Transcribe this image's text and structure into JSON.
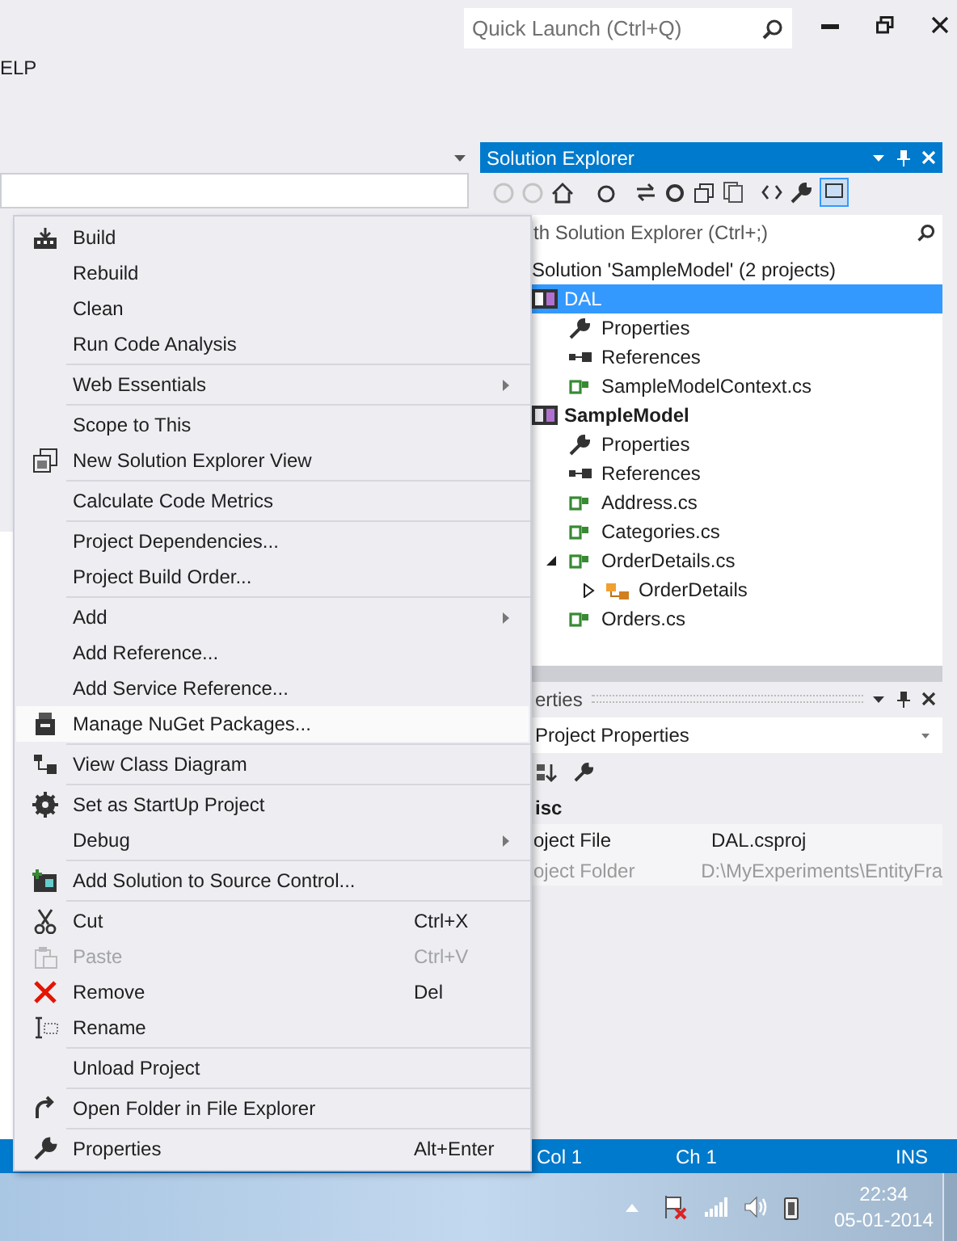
{
  "window": {
    "quick_launch": {
      "placeholder": "Quick Launch (Ctrl+Q)"
    }
  },
  "menu_bar": {
    "label": "ELP"
  },
  "solution_explorer": {
    "title": "Solution Explorer",
    "search": {
      "placeholder": "th Solution Explorer (Ctrl+;)"
    },
    "tree": [
      {
        "label": "Solution 'SampleModel' (2 projects)",
        "selected": false,
        "children": [
          {
            "label": "DAL",
            "kind": "project",
            "startup": false,
            "selected": true,
            "children": [
              {
                "label": "Properties",
                "kind": "properties",
                "selected": false
              },
              {
                "label": "References",
                "kind": "references",
                "selected": false
              },
              {
                "label": "SampleModelContext.cs",
                "kind": "file",
                "selected": false
              }
            ]
          },
          {
            "label": "SampleModel",
            "kind": "project",
            "startup": true,
            "selected": false,
            "children": [
              {
                "label": "Properties",
                "kind": "properties",
                "selected": false
              },
              {
                "label": "References",
                "kind": "references",
                "selected": false
              },
              {
                "label": "Address.cs",
                "kind": "file",
                "selected": false
              },
              {
                "label": "Categories.cs",
                "kind": "file",
                "selected": false
              },
              {
                "label": "OrderDetails.cs",
                "kind": "file",
                "selected": false,
                "expanded": true,
                "children": [
                  {
                    "label": "OrderDetails",
                    "kind": "class",
                    "selected": false,
                    "expanded": false
                  }
                ]
              },
              {
                "label": "Orders.cs",
                "kind": "file",
                "selected": false
              }
            ]
          }
        ]
      }
    ]
  },
  "properties": {
    "title": "erties",
    "object": "Project Properties",
    "category": "isc",
    "rows": [
      {
        "name": "oject File",
        "value": "DAL.csproj",
        "disabled": false
      },
      {
        "name": "oject Folder",
        "value": "D:\\MyExperiments\\EntityFra",
        "disabled": true
      }
    ]
  },
  "context_menu": {
    "groups": [
      [
        {
          "label": "Build",
          "submenu": false,
          "disabled": false,
          "selected": false
        },
        {
          "label": "Rebuild",
          "submenu": false,
          "disabled": false,
          "selected": false
        },
        {
          "label": "Clean",
          "submenu": false,
          "disabled": false,
          "selected": false
        },
        {
          "label": "Run Code Analysis",
          "submenu": false,
          "disabled": false,
          "selected": false
        }
      ],
      [
        {
          "label": "Web Essentials",
          "submenu": true,
          "disabled": false,
          "selected": false
        }
      ],
      [
        {
          "label": "Scope to This",
          "submenu": false,
          "disabled": false,
          "selected": false
        },
        {
          "label": "New Solution Explorer View",
          "submenu": false,
          "disabled": false,
          "selected": false
        }
      ],
      [
        {
          "label": "Calculate Code Metrics",
          "submenu": false,
          "disabled": false,
          "selected": false
        }
      ],
      [
        {
          "label": "Project Dependencies...",
          "submenu": false,
          "disabled": false,
          "selected": false
        },
        {
          "label": "Project Build Order...",
          "submenu": false,
          "disabled": false,
          "selected": false
        }
      ],
      [
        {
          "label": "Add",
          "submenu": true,
          "disabled": false,
          "selected": false
        },
        {
          "label": "Add Reference...",
          "submenu": false,
          "disabled": false,
          "selected": false
        },
        {
          "label": "Add Service Reference...",
          "submenu": false,
          "disabled": false,
          "selected": false
        },
        {
          "label": "Manage NuGet Packages...",
          "submenu": false,
          "disabled": false,
          "selected": true
        }
      ],
      [
        {
          "label": "View Class Diagram",
          "submenu": false,
          "disabled": false,
          "selected": false
        }
      ],
      [
        {
          "label": "Set as StartUp Project",
          "submenu": false,
          "disabled": false,
          "selected": false
        },
        {
          "label": "Debug",
          "submenu": true,
          "disabled": false,
          "selected": false
        }
      ],
      [
        {
          "label": "Add Solution to Source Control...",
          "submenu": false,
          "disabled": false,
          "selected": false
        }
      ],
      [
        {
          "label": "Cut",
          "shortcut": "Ctrl+X",
          "submenu": false,
          "disabled": false,
          "selected": false
        },
        {
          "label": "Paste",
          "shortcut": "Ctrl+V",
          "submenu": false,
          "disabled": true,
          "selected": false
        },
        {
          "label": "Remove",
          "shortcut": "Del",
          "submenu": false,
          "disabled": false,
          "selected": false
        },
        {
          "label": "Rename",
          "submenu": false,
          "disabled": false,
          "selected": false
        }
      ],
      [
        {
          "label": "Unload Project",
          "submenu": false,
          "disabled": false,
          "selected": false
        }
      ],
      [
        {
          "label": "Open Folder in File Explorer",
          "submenu": false,
          "disabled": false,
          "selected": false
        }
      ],
      [
        {
          "label": "Properties",
          "shortcut": "Alt+Enter",
          "submenu": false,
          "disabled": false,
          "selected": false
        }
      ]
    ]
  },
  "status_bar": {
    "column": "Col 1",
    "char": "Ch 1",
    "mode": "INS"
  },
  "taskbar": {
    "time": "22:34",
    "date": "05-01-2014"
  }
}
